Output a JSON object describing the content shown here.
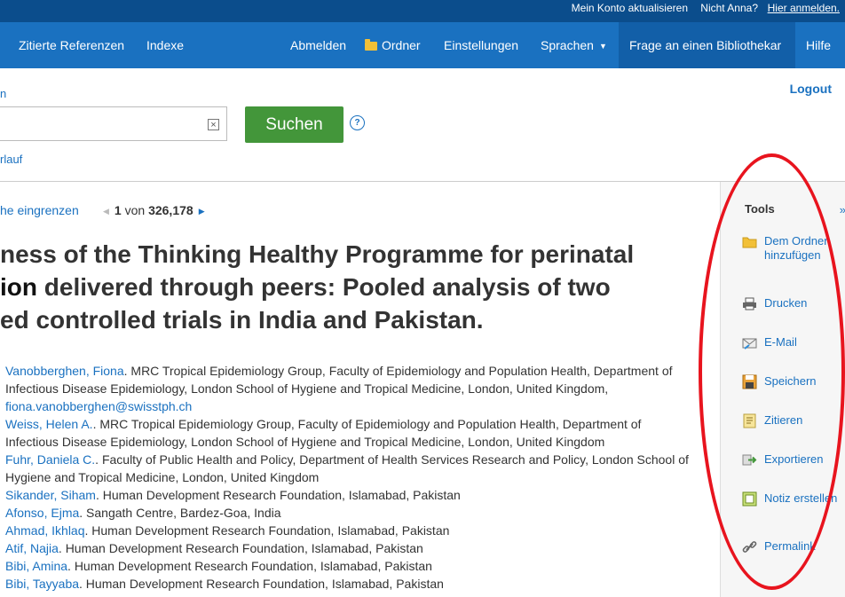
{
  "topbar": {
    "account_label": "Mein Konto aktualisieren",
    "not_user_label": "Nicht Anna?",
    "sign_in_label": "Hier anmelden."
  },
  "nav": {
    "cited_refs": "Zitierte Referenzen",
    "indexes": "Indexe",
    "logout": "Abmelden",
    "folder": "Ordner",
    "settings": "Einstellungen",
    "languages": "Sprachen",
    "ask_librarian": "Frage an einen Bibliothekar",
    "help": "Hilfe"
  },
  "search": {
    "top_link_fragment": "n",
    "logout": "Logout",
    "input_value": "",
    "clear_glyph": "×",
    "button_label": "Suchen",
    "help_glyph": "?",
    "history_fragment": "rlauf"
  },
  "results": {
    "refine_fragment": "he eingrenzen",
    "current": "1",
    "of_label": "von",
    "total": "326,178"
  },
  "article": {
    "title_lines": [
      {
        "pre": "ness of the Thinking Healthy Programme for perinatal",
        "strong": "",
        "post": ""
      },
      {
        "pre": "",
        "strong": "ion",
        "post": " delivered through peers: Pooled analysis of two"
      },
      {
        "pre": "ed controlled trials in India and Pakistan.",
        "strong": "",
        "post": ""
      }
    ],
    "authors": [
      {
        "name": "Vanobberghen, Fiona",
        "affiliation": ". MRC Tropical Epidemiology Group, Faculty of Epidemiology and Population Health, Department of Infectious Disease Epidemiology, London School of Hygiene and Tropical Medicine, London, United Kingdom,",
        "email": "fiona.vanobberghen@swisstph.ch"
      },
      {
        "name": "Weiss, Helen A.",
        "affiliation": ". MRC Tropical Epidemiology Group, Faculty of Epidemiology and Population Health, Department of Infectious Disease Epidemiology, London School of Hygiene and Tropical Medicine, London, United Kingdom",
        "email": ""
      },
      {
        "name": "Fuhr, Daniela C.",
        "affiliation": ". Faculty of Public Health and Policy, Department of Health Services Research and Policy, London School of Hygiene and Tropical Medicine, London, United Kingdom",
        "email": ""
      },
      {
        "name": "Sikander, Siham",
        "affiliation": ". Human Development Research Foundation, Islamabad, Pakistan",
        "email": ""
      },
      {
        "name": "Afonso, Ejma",
        "affiliation": ". Sangath Centre, Bardez-Goa, India",
        "email": ""
      },
      {
        "name": "Ahmad, Ikhlaq",
        "affiliation": ". Human Development Research Foundation, Islamabad, Pakistan",
        "email": ""
      },
      {
        "name": "Atif, Najia",
        "affiliation": ". Human Development Research Foundation, Islamabad, Pakistan",
        "email": ""
      },
      {
        "name": "Bibi, Amina",
        "affiliation": ". Human Development Research Foundation, Islamabad, Pakistan",
        "email": ""
      },
      {
        "name": "Bibi, Tayyaba",
        "affiliation": ". Human Development Research Foundation, Islamabad, Pakistan",
        "email": ""
      }
    ]
  },
  "sidebar": {
    "heading": "Tools",
    "collapse_glyph": "»",
    "tools": [
      {
        "label": "Dem Ordner hinzufügen",
        "icon": "folder-icon"
      },
      {
        "label": "Drucken",
        "icon": "printer-icon"
      },
      {
        "label": "E-Mail",
        "icon": "email-icon"
      },
      {
        "label": "Speichern",
        "icon": "floppy-disk-icon"
      },
      {
        "label": "Zitieren",
        "icon": "cite-icon"
      },
      {
        "label": "Exportieren",
        "icon": "export-icon"
      },
      {
        "label": "Notiz erstellen",
        "icon": "note-icon"
      },
      {
        "label": "Permalink",
        "icon": "link-icon"
      }
    ]
  },
  "colors": {
    "topbar": "#0b4d8c",
    "navbar": "#1a71c0",
    "link": "#1a71c0",
    "search_button": "#43963a",
    "annotation": "#e8141e"
  }
}
